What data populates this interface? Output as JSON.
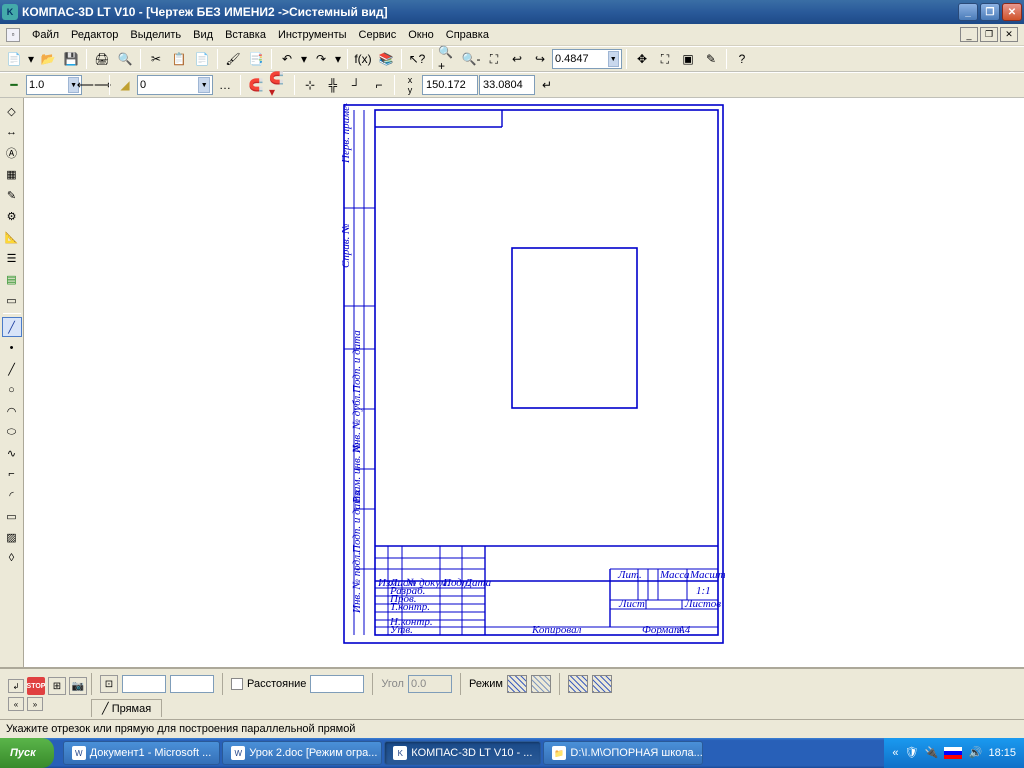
{
  "title": "КОМПАС-3D LT V10 - [Чертеж БЕЗ ИМЕНИ2 ->Системный вид]",
  "menu": {
    "file": "Файл",
    "edit": "Редактор",
    "select": "Выделить",
    "view": "Вид",
    "insert": "Вставка",
    "tools": "Инструменты",
    "service": "Сервис",
    "window": "Окно",
    "help": "Справка"
  },
  "toolbar2": {
    "linewidth": "1.0",
    "layer": "0",
    "zoom": "0.4847",
    "coord_x": "150.172",
    "coord_y": "33.0804"
  },
  "bottom": {
    "stop": "STOP",
    "distance_label": "Расстояние",
    "distance_val": "",
    "angle_label": "Угол",
    "angle_val": "0.0",
    "mode_label": "Режим",
    "tab_label": "Прямая"
  },
  "status": "Укажите отрезок или прямую для построения параллельной прямой",
  "titleblock": {
    "kopiroval": "Копировал",
    "format": "Формат",
    "a4": "A4",
    "list": "Лист",
    "listov": "Листов",
    "massa": "Масса",
    "masshtab": "Масштаб",
    "one_one": "1:1",
    "lit": "Лит.",
    "razrab": "Разраб.",
    "prov": "Пров.",
    "tkontr": "Т.контр.",
    "nkontr": "Н.контр.",
    "utv": "Утв.",
    "izm": "Изм.",
    "list2": "Лист",
    "ndok": "№ докум.",
    "podp": "Подп.",
    "data": "Дата",
    "spravn": "Справ. №",
    "pervprim": "Перв. примен.",
    "podpdata1": "Подп. и дата",
    "invdub": "Инв. № дубл.",
    "vzaminv": "Взам. инв. №",
    "podpdata2": "Подп. и дата",
    "invpodl": "Инв. № подл."
  },
  "taskbar": {
    "start": "Пуск",
    "items": [
      {
        "label": "Документ1 - Microsoft ..."
      },
      {
        "label": "Урок 2.doc [Режим огра..."
      },
      {
        "label": "КОМПАС-3D LT V10 - ...",
        "active": true
      },
      {
        "label": "D:\\I.M\\ОПОРНАЯ школа..."
      }
    ],
    "time": "18:15"
  }
}
